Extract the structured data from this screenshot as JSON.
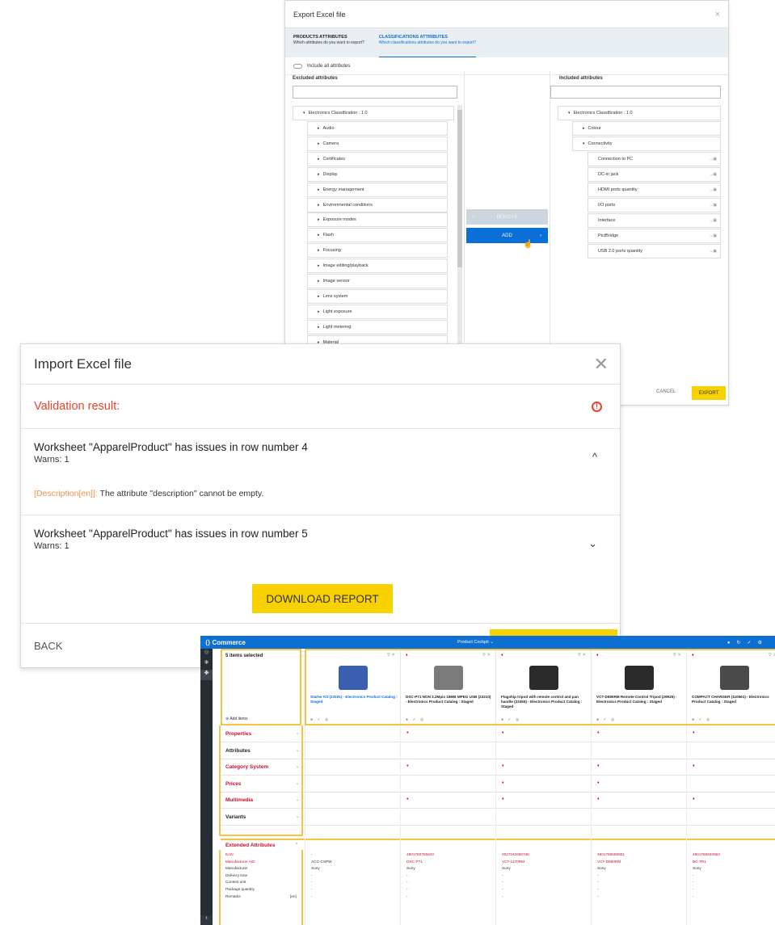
{
  "export_dialog": {
    "title": "Export Excel file",
    "close": "×",
    "steps": [
      {
        "title": "PRODUCTS ATTRIBUTES",
        "subtitle": "Which attributes do you want to export?"
      },
      {
        "title": "CLASSIFICATIONS ATTRIBUTES",
        "subtitle": "Which classifications attributes do you want to export?"
      }
    ],
    "include_all_label": "Include all attributes",
    "excluded_title": "Excluded attributes",
    "included_title": "Included attributes",
    "excluded_root": "Electronics Classification : 1.0",
    "excluded_items": [
      "Audio",
      "Camera",
      "Certificates",
      "Display",
      "Energy management",
      "Environmental conditions",
      "Exposure modes",
      "Flash",
      "Focusing",
      "Image editing/playback",
      "Image sensor",
      "Lens system",
      "Light exposure",
      "Light metering",
      "Material"
    ],
    "included_root": "Electronics Classification : 1.0",
    "included_groups": [
      "Colour",
      "Connectivity"
    ],
    "included_items": [
      "Connection to PC",
      "DC-in jack",
      "HDMI ports quantity",
      "I/O ports",
      "Interface",
      "PictBridge",
      "USB 2.0 ports quantity"
    ],
    "remove_label": "REMOVE",
    "add_label": "ADD",
    "cancel_label": "CANCEL",
    "export_label": "EXPORT"
  },
  "import_dialog": {
    "title": "Import Excel file",
    "close": "✕",
    "validation": "Validation result:",
    "issues": [
      {
        "title": "Worksheet \"ApparelProduct\" has issues in row number 4",
        "warns": "Warns: 1",
        "chevron": "^"
      },
      {
        "title": "Worksheet \"ApparelProduct\" has issues in row number 5",
        "warns": "Warns: 1",
        "chevron": "⌄"
      }
    ],
    "message_field": "[Description[en]]:",
    "message_text": " The attribute \"description\" cannot be empty.",
    "download_label": "DOWNLOAD REPORT",
    "back_label": "BACK"
  },
  "cockpit": {
    "brand": "Commerce",
    "perspective": "Product Cockpit",
    "selection": "5 items selected",
    "add_items": "Add items",
    "products": [
      {
        "name": "Starter Kit (23191) - Electronics Product Catalog : Staged",
        "color": "#3a5fb0"
      },
      {
        "name": "DSC-P71 NON 3.2Mpix 16MB MPEG USB (23210) - Electronics Product Catalog : Staged",
        "color": "#7a7a7a"
      },
      {
        "name": "Flagship tripod with remote control and pan handle (23355) - Electronics Product Catalog : Staged",
        "color": "#2b2b2b"
      },
      {
        "name": "VCT-D580RM Remote Control Tripod (29925) - Electronics Product Catalog : Staged",
        "color": "#2b2b2b"
      },
      {
        "name": "COMPACT CHARGER (110561) - Electronics Product Catalog : Staged",
        "color": "#4a4a4a"
      }
    ],
    "sections": [
      {
        "label": "Properties",
        "red": true
      },
      {
        "label": "Attributes",
        "red": false
      },
      {
        "label": "Category System",
        "red": true
      },
      {
        "label": "Prices",
        "red": true
      },
      {
        "label": "Multimedia",
        "red": true
      },
      {
        "label": "Variants",
        "red": false
      }
    ],
    "extended_label": "Extended Attributes",
    "ext_rows": [
      {
        "key": "EAN",
        "red": true,
        "values": [
          "-",
          "4901780755943",
          "0027242680746",
          "4901780680801",
          "4901780840953"
        ]
      },
      {
        "key": "Manufacturer AID",
        "red": true,
        "values": [
          "ACC-CSPW",
          "DSC-P71",
          "VCT-1170RM",
          "VCT-D580RM",
          "BC-TR1"
        ]
      },
      {
        "key": "Manufacturer",
        "red": false,
        "values": [
          "Sony",
          "Sony",
          "Sony",
          "Sony",
          "Sony"
        ]
      },
      {
        "key": "Delivery time",
        "red": false,
        "values": [
          "-",
          "-",
          "-",
          "-",
          "-"
        ]
      },
      {
        "key": "Content unit",
        "red": false,
        "values": [
          "-",
          "-",
          "-",
          "-",
          "-"
        ]
      },
      {
        "key": "Package quantity",
        "red": false,
        "values": [
          "-",
          "-",
          "-",
          "-",
          "-"
        ]
      },
      {
        "key": "Remarks",
        "red": false,
        "values": [
          "-",
          "-",
          "-",
          "-",
          "-"
        ]
      }
    ],
    "remarks_lang": "[en]"
  }
}
